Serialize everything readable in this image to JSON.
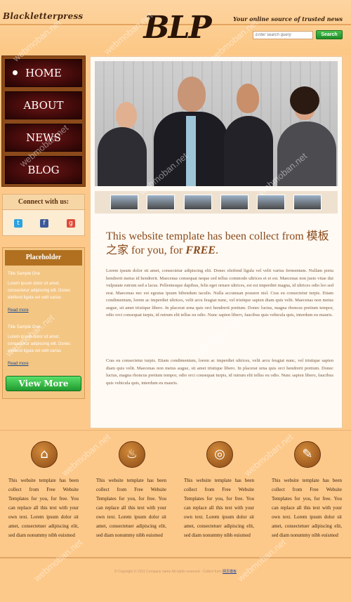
{
  "header": {
    "brand_small": "Blackletterpress",
    "logo": "BLP",
    "tagline": "Your online source of trusted news",
    "search_placeholder": "Enter search query",
    "search_button": "Search"
  },
  "nav": {
    "items": [
      {
        "label": "HOME"
      },
      {
        "label": "ABOUT"
      },
      {
        "label": "NEWS"
      },
      {
        "label": "BLOG"
      }
    ]
  },
  "connect": {
    "title": "Connect with us:",
    "icons": [
      "twitter-icon",
      "facebook-icon",
      "google-plus-icon"
    ]
  },
  "placeholder": {
    "title": "Placeholder",
    "items": [
      {
        "title": "Title Sample One",
        "text": "Lorem ipsum dolor sit amet, consectetur adipiscing elit. Donec eleifend ligula vel velit varius",
        "more": "Read more"
      },
      {
        "title": "Title Sample One",
        "text": "Lorem ipsum dolor sit amet, consectetur adipiscing elit. Donec eleifend ligula vel velit varius",
        "more": "Read more"
      }
    ],
    "view_more": "View More"
  },
  "main": {
    "title_prefix": "This website template has been collect from 模板之家 for you, for ",
    "title_emph": "FREE",
    "title_suffix": ".",
    "paragraphs": [
      "Lorem ipsum dolor sit amet, consectetur adipiscing elit. Donec eleifend ligula vel velit varius fermentum. Nullam porta hendrerit metus id hendrerit. Maecenas consequat neque sed tellus commodo ultrices et et est. Maecenas non justo vitae dui vulputate rutrum sed a lacus. Pellentesque dapibus, felis eget ornare ultrices, est est imperdiet magna, id ultrices odio leo sed erat. Maecenas nec est egestas ipsum bibendum iaculis. Nulla accumsan posuere nisl. Cras eu consectetur turpis. Etiam condimentum, lorem ac imperdiet ultrices, velit arcu feugiat nunc, vel tristique sapien diam quis velit. Maecenas non metus augue, sit amet tristique libero. In placerat urna quis orci hendrerit pretium. Donec luctus, magna rhoncus pretium tempor, odio orci consequat turpis, id rutrum elit tellus eu odio. Nunc sapien libero, faucibus quis vehicula quis, interdum eu mauris.",
      "Cras eu consectetur turpis. Etiam condimentum, lorem ac imperdiet ultrices, velit arcu feugiat nunc, vel tristique sapien diam quis velit. Maecenas non metus augue, sit amet tristique libero. In placerat urna quis orci hendrerit pretium. Donec luctus, magna rhoncus pretium tempor, odio orci consequat turpis, id rutrum elit tellus eu odio. Nunc sapien libero, faucibus quis vehicula quis, interdum eu mauris."
    ]
  },
  "features": [
    {
      "icon": "home-icon",
      "text": "This website template has been collect from Free Website Templates for you, for free. You can replace all this text with your own text. Lorem ipsum dolor sit amet, consectetuer adipiscing elit, sed diam nonummy nibh euismod"
    },
    {
      "icon": "bell-icon",
      "text": "This website template has been collect from Free Website Templates for you, for free. You can replace all this text with your own text. Lorem ipsum dolor sit amet, consectetuer adipiscing elit, sed diam nonummy nibh euismod"
    },
    {
      "icon": "globe-icon",
      "text": "This website template has been collect from Free Website Templates for you, for free. You can replace all this text with your own text. Lorem ipsum dolor sit amet, consectetuer adipiscing elit, sed diam nonummy nibh euismod"
    },
    {
      "icon": "pencil-icon",
      "text": "This website template has been collect from Free Website Templates for you, for free. You can replace all this text with your own text. Lorem ipsum dolor sit amet, consectetuer adipiscing elit, sed diam nonummy nibh euismod"
    }
  ],
  "footer": {
    "copyright": "© Copyright © 2011 Company name All rights reserved - Collect from ",
    "link": "网页模板"
  },
  "watermark": "webmoban.net"
}
